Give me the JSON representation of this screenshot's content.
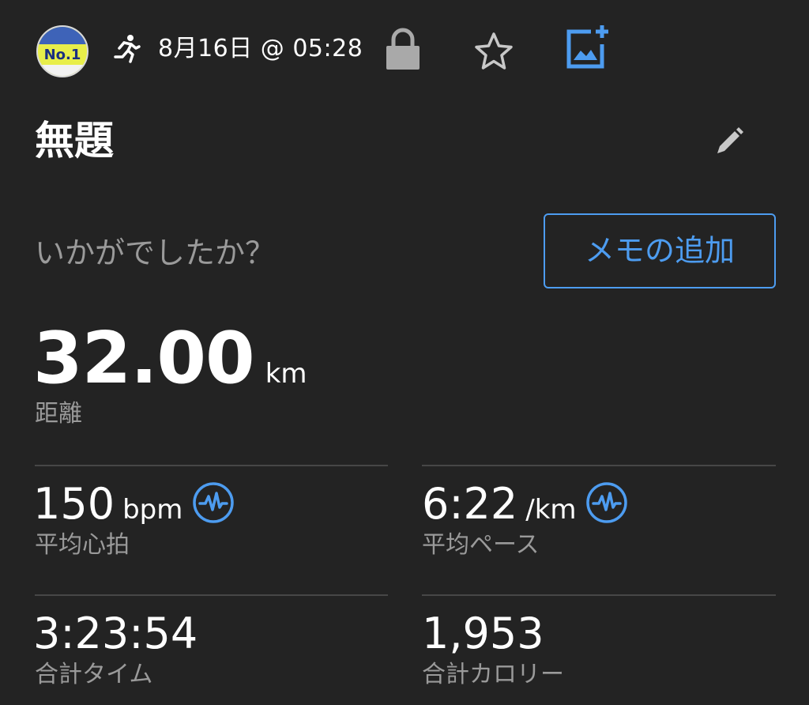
{
  "header": {
    "avatar_text": "No.1",
    "datetime": "8月16日 @ 05:28",
    "icons": [
      "running-icon",
      "lock-icon",
      "star-icon",
      "add-photo-icon"
    ]
  },
  "title": "無題",
  "edit_icon": "pencil-icon",
  "prompt": "いかがでしたか？",
  "memo_button_label": "メモの追加",
  "distance": {
    "value": "32.00",
    "unit": "km",
    "label": "距離"
  },
  "stats": {
    "avg_hr": {
      "value": "150",
      "unit": "bpm",
      "label": "平均心拍",
      "icon": "pulse-icon"
    },
    "avg_pace": {
      "value": "6:22",
      "unit": "/km",
      "label": "平均ペース",
      "icon": "pulse-icon"
    },
    "total_time": {
      "value": "3:23:54",
      "label": "合計タイム"
    },
    "calories": {
      "value": "1,953",
      "label": "合計カロリー"
    }
  },
  "colors": {
    "background": "#232323",
    "accent": "#4d9cf0",
    "secondary_text": "#9a9a9a",
    "divider": "#474747"
  }
}
